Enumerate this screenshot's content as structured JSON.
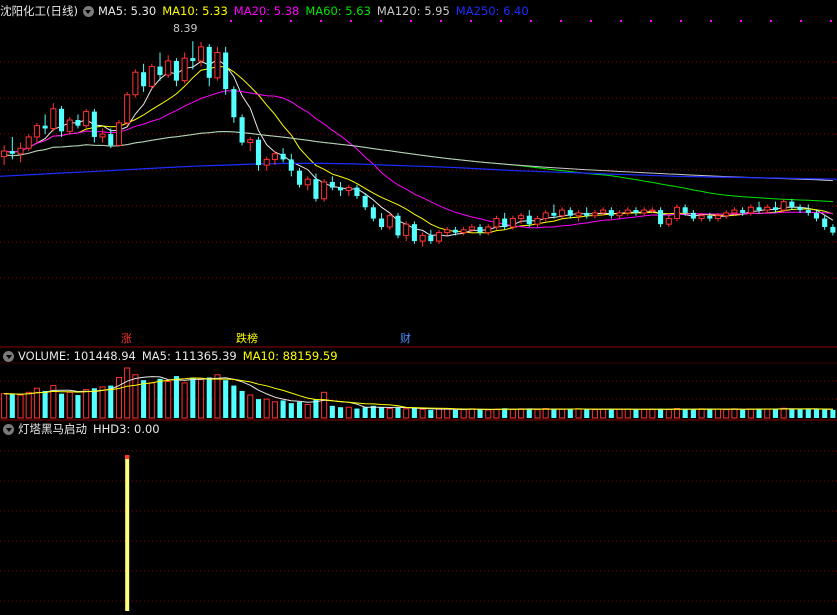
{
  "stock_title": "沈阳化工(日线)",
  "colors": {
    "up": "#ff3232",
    "down": "#54ffff",
    "ma5": "#e8e8e8",
    "ma10": "#ffff00",
    "ma20": "#ff00ff",
    "ma60": "#00e600",
    "ma120": "#c8c8c8",
    "ma250": "#1e2dff",
    "grid": "#8b0000",
    "sep": "#8b0000"
  },
  "ma_legend": [
    {
      "label": "MA5: 5.30",
      "color": "#e8e8e8"
    },
    {
      "label": "MA10: 5.33",
      "color": "#ffff00"
    },
    {
      "label": "MA20: 5.38",
      "color": "#ff00ff"
    },
    {
      "label": "MA60: 5.63",
      "color": "#00e600"
    },
    {
      "label": "MA120: 5.95",
      "color": "#c8c8c8"
    },
    {
      "label": "MA250: 6.40",
      "color": "#1e2dff"
    }
  ],
  "peak_label": "8.39",
  "markers": [
    {
      "text": "涨",
      "color": "#ff3232",
      "bar": 15
    },
    {
      "text": "跌榜",
      "color": "#ffff00",
      "bar": 29
    },
    {
      "text": "财",
      "color": "#4d8dff",
      "bar": 49
    }
  ],
  "volume_legend": [
    {
      "label": "VOLUME: 101448.94",
      "color": "#e8e8e8"
    },
    {
      "label": "MA5: 111365.39",
      "color": "#e8e8e8"
    },
    {
      "label": "MA10: 88159.59",
      "color": "#ffff00"
    }
  ],
  "indicator_legend": [
    {
      "label": "灯塔黑马启动",
      "color": "#e8e8e8"
    },
    {
      "label": "HHD3: 0.00",
      "color": "#e8e8e8"
    }
  ],
  "chart_data": {
    "type": "candlestick",
    "price_range": [
      4.3,
      8.6
    ],
    "candles": [
      [
        6.35,
        6.55,
        6.2,
        6.45
      ],
      [
        6.45,
        6.7,
        6.3,
        6.4
      ],
      [
        6.4,
        6.6,
        6.25,
        6.5
      ],
      [
        6.5,
        6.75,
        6.45,
        6.7
      ],
      [
        6.7,
        6.95,
        6.6,
        6.9
      ],
      [
        6.9,
        7.1,
        6.75,
        6.85
      ],
      [
        6.85,
        7.3,
        6.8,
        7.2
      ],
      [
        7.2,
        7.25,
        6.7,
        6.8
      ],
      [
        6.8,
        7.05,
        6.75,
        7.0
      ],
      [
        7.0,
        7.1,
        6.85,
        6.9
      ],
      [
        6.9,
        7.2,
        6.85,
        7.15
      ],
      [
        7.15,
        7.2,
        6.6,
        6.7
      ],
      [
        6.7,
        6.85,
        6.6,
        6.75
      ],
      [
        6.75,
        6.85,
        6.5,
        6.55
      ],
      [
        6.55,
        7.0,
        6.55,
        6.95
      ],
      [
        6.95,
        7.5,
        6.9,
        7.45
      ],
      [
        7.45,
        7.9,
        7.4,
        7.85
      ],
      [
        7.85,
        8.0,
        7.5,
        7.6
      ],
      [
        7.6,
        8.0,
        7.55,
        7.95
      ],
      [
        7.95,
        8.2,
        7.7,
        7.8
      ],
      [
        7.8,
        8.15,
        7.75,
        8.05
      ],
      [
        8.05,
        8.1,
        7.6,
        7.7
      ],
      [
        7.7,
        8.2,
        7.65,
        8.1
      ],
      [
        8.1,
        8.4,
        7.9,
        8.05
      ],
      [
        8.05,
        8.39,
        7.95,
        8.3
      ],
      [
        8.3,
        8.35,
        7.6,
        7.75
      ],
      [
        7.75,
        8.3,
        7.7,
        8.2
      ],
      [
        8.2,
        8.3,
        7.45,
        7.55
      ],
      [
        7.55,
        7.6,
        6.95,
        7.05
      ],
      [
        7.05,
        7.1,
        6.55,
        6.6
      ],
      [
        6.6,
        6.7,
        6.45,
        6.65
      ],
      [
        6.65,
        6.7,
        6.1,
        6.2
      ],
      [
        6.2,
        6.35,
        6.1,
        6.3
      ],
      [
        6.3,
        6.45,
        6.2,
        6.4
      ],
      [
        6.4,
        6.5,
        6.25,
        6.3
      ],
      [
        6.3,
        6.4,
        6.0,
        6.1
      ],
      [
        6.1,
        6.15,
        5.8,
        5.85
      ],
      [
        5.85,
        6.0,
        5.75,
        5.95
      ],
      [
        5.95,
        6.05,
        5.55,
        5.6
      ],
      [
        5.6,
        5.95,
        5.55,
        5.9
      ],
      [
        5.9,
        6.0,
        5.75,
        5.8
      ],
      [
        5.8,
        5.9,
        5.65,
        5.75
      ],
      [
        5.75,
        5.85,
        5.65,
        5.8
      ],
      [
        5.8,
        5.85,
        5.6,
        5.65
      ],
      [
        5.65,
        5.7,
        5.4,
        5.45
      ],
      [
        5.45,
        5.5,
        5.2,
        5.25
      ],
      [
        5.25,
        5.35,
        5.05,
        5.1
      ],
      [
        5.1,
        5.35,
        5.05,
        5.3
      ],
      [
        5.3,
        5.35,
        4.9,
        4.95
      ],
      [
        4.95,
        5.2,
        4.85,
        5.15
      ],
      [
        5.15,
        5.2,
        4.8,
        4.85
      ],
      [
        4.85,
        5.0,
        4.75,
        4.95
      ],
      [
        4.95,
        5.05,
        4.8,
        4.85
      ],
      [
        4.85,
        5.05,
        4.8,
        5.0
      ],
      [
        5.0,
        5.1,
        4.95,
        5.05
      ],
      [
        5.05,
        5.1,
        4.95,
        5.0
      ],
      [
        5.0,
        5.1,
        4.95,
        5.05
      ],
      [
        5.05,
        5.15,
        5.0,
        5.1
      ],
      [
        5.1,
        5.15,
        4.95,
        5.0
      ],
      [
        5.0,
        5.15,
        4.95,
        5.1
      ],
      [
        5.1,
        5.3,
        5.05,
        5.25
      ],
      [
        5.25,
        5.35,
        5.05,
        5.1
      ],
      [
        5.1,
        5.3,
        5.05,
        5.25
      ],
      [
        5.25,
        5.35,
        5.15,
        5.3
      ],
      [
        5.3,
        5.4,
        5.1,
        5.15
      ],
      [
        5.15,
        5.3,
        5.1,
        5.25
      ],
      [
        5.25,
        5.4,
        5.2,
        5.35
      ],
      [
        5.35,
        5.5,
        5.25,
        5.3
      ],
      [
        5.3,
        5.45,
        5.25,
        5.4
      ],
      [
        5.4,
        5.45,
        5.25,
        5.3
      ],
      [
        5.3,
        5.4,
        5.2,
        5.35
      ],
      [
        5.35,
        5.45,
        5.25,
        5.3
      ],
      [
        5.3,
        5.4,
        5.25,
        5.35
      ],
      [
        5.35,
        5.45,
        5.3,
        5.4
      ],
      [
        5.4,
        5.45,
        5.25,
        5.3
      ],
      [
        5.3,
        5.4,
        5.25,
        5.35
      ],
      [
        5.35,
        5.45,
        5.3,
        5.4
      ],
      [
        5.4,
        5.45,
        5.3,
        5.35
      ],
      [
        5.35,
        5.45,
        5.3,
        5.4
      ],
      [
        5.4,
        5.45,
        5.35,
        5.4
      ],
      [
        5.4,
        5.45,
        5.1,
        5.15
      ],
      [
        5.15,
        5.3,
        5.1,
        5.25
      ],
      [
        5.25,
        5.5,
        5.2,
        5.45
      ],
      [
        5.45,
        5.5,
        5.3,
        5.35
      ],
      [
        5.35,
        5.4,
        5.2,
        5.25
      ],
      [
        5.25,
        5.35,
        5.2,
        5.3
      ],
      [
        5.3,
        5.35,
        5.2,
        5.25
      ],
      [
        5.25,
        5.35,
        5.2,
        5.3
      ],
      [
        5.3,
        5.4,
        5.25,
        5.35
      ],
      [
        5.35,
        5.45,
        5.3,
        5.4
      ],
      [
        5.4,
        5.45,
        5.3,
        5.35
      ],
      [
        5.35,
        5.5,
        5.3,
        5.45
      ],
      [
        5.45,
        5.55,
        5.35,
        5.4
      ],
      [
        5.4,
        5.5,
        5.35,
        5.45
      ],
      [
        5.45,
        5.55,
        5.35,
        5.4
      ],
      [
        5.4,
        5.6,
        5.35,
        5.55
      ],
      [
        5.55,
        5.6,
        5.4,
        5.45
      ],
      [
        5.45,
        5.5,
        5.35,
        5.4
      ],
      [
        5.4,
        5.5,
        5.3,
        5.35
      ],
      [
        5.35,
        5.4,
        5.2,
        5.25
      ],
      [
        5.25,
        5.3,
        5.05,
        5.1
      ],
      [
        5.1,
        5.15,
        4.95,
        5.0
      ]
    ],
    "volume": [
      90,
      88,
      85,
      95,
      110,
      100,
      120,
      90,
      95,
      85,
      105,
      110,
      115,
      120,
      150,
      185,
      160,
      140,
      130,
      145,
      135,
      155,
      130,
      150,
      145,
      150,
      160,
      140,
      120,
      100,
      85,
      70,
      70,
      60,
      65,
      55,
      60,
      50,
      70,
      95,
      45,
      40,
      40,
      35,
      40,
      45,
      40,
      35,
      38,
      34,
      36,
      32,
      30,
      33,
      34,
      30,
      31,
      34,
      32,
      30,
      33,
      36,
      32,
      34,
      33,
      31,
      35,
      34,
      32,
      33,
      34,
      32,
      31,
      33,
      34,
      32,
      33,
      31,
      32,
      33,
      34,
      31,
      35,
      32,
      33,
      34,
      32,
      33,
      31,
      34,
      32,
      33,
      35,
      33,
      34,
      36,
      33,
      32,
      34,
      33,
      31,
      30
    ],
    "ma_window": [
      5,
      10,
      20,
      60,
      120
    ],
    "ma250_series": [
      6.0,
      6.03,
      6.06,
      6.09,
      6.12,
      6.15,
      6.18,
      6.2,
      6.22,
      6.23,
      6.23,
      6.22,
      6.2,
      6.18,
      6.16,
      6.13,
      6.1,
      6.08,
      6.06,
      6.04,
      6.02,
      6.0,
      5.99,
      5.98,
      5.97,
      5.96,
      5.95
    ],
    "indicator_signal_bar": 15
  }
}
